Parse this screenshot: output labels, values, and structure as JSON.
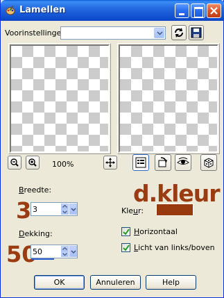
{
  "window": {
    "title": "Lamellen",
    "title_icon": "paint-shop-app-icon"
  },
  "titlebar_buttons": {
    "minimize": "minimize-icon",
    "maximize": "maximize-icon",
    "close": "close-icon"
  },
  "presets": {
    "label": "Voorinstellingen:",
    "value": ""
  },
  "zoom": {
    "value": "100%"
  },
  "width": {
    "label": "Breedte:",
    "value": "3",
    "annotation": "3"
  },
  "opacity": {
    "label": "Dekking:",
    "value": "50",
    "annotation": "50"
  },
  "color": {
    "annotation": "d.kleur",
    "label": "Kleur:",
    "value_hex": "#993a0e"
  },
  "options": {
    "horizontal": {
      "label": "Horizontaal",
      "checked": true
    },
    "light_from": {
      "label": "Licht van links/boven",
      "checked": true
    }
  },
  "buttons": {
    "ok": "OK",
    "cancel": "Annuleren",
    "help": "Help"
  },
  "colors": {
    "annotation": "#9b3b12",
    "titlebar": "#2469e0"
  }
}
